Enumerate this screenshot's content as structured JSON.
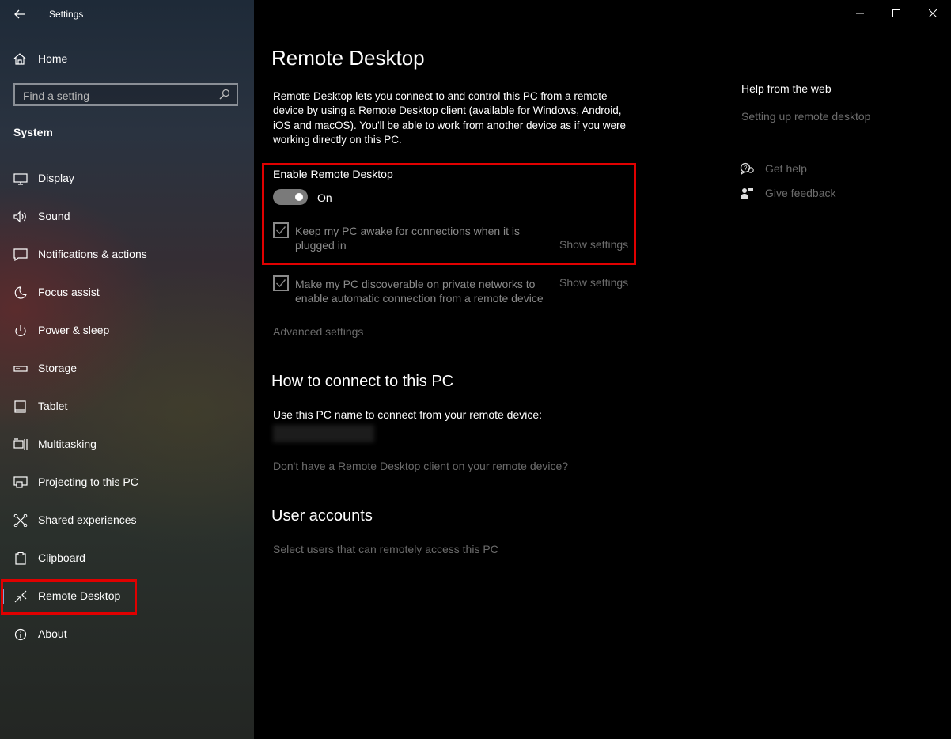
{
  "window": {
    "title": "Settings"
  },
  "sidebar": {
    "home_label": "Home",
    "search_placeholder": "Find a setting",
    "section": "System",
    "items": [
      {
        "label": "Display",
        "icon": "display-icon"
      },
      {
        "label": "Sound",
        "icon": "speaker-icon"
      },
      {
        "label": "Notifications & actions",
        "icon": "notification-icon"
      },
      {
        "label": "Focus assist",
        "icon": "moon-icon"
      },
      {
        "label": "Power & sleep",
        "icon": "power-icon"
      },
      {
        "label": "Storage",
        "icon": "storage-icon"
      },
      {
        "label": "Tablet",
        "icon": "tablet-icon"
      },
      {
        "label": "Multitasking",
        "icon": "multitasking-icon"
      },
      {
        "label": "Projecting to this PC",
        "icon": "projecting-icon"
      },
      {
        "label": "Shared experiences",
        "icon": "shared-icon"
      },
      {
        "label": "Clipboard",
        "icon": "clipboard-icon"
      },
      {
        "label": "Remote Desktop",
        "icon": "remote-desktop-icon",
        "selected": true
      },
      {
        "label": "About",
        "icon": "info-icon"
      }
    ]
  },
  "main": {
    "title": "Remote Desktop",
    "description": "Remote Desktop lets you connect to and control this PC from a remote device by using a Remote Desktop client (available for Windows, Android, iOS and macOS). You'll be able to work from another device as if you were working directly on this PC.",
    "enable_label": "Enable Remote Desktop",
    "toggle_state": "On",
    "keep_awake": "Keep my PC awake for connections when it is plugged in",
    "discoverable": "Make my PC discoverable on private networks to enable automatic connection from a remote device",
    "show_settings": "Show settings",
    "advanced_settings": "Advanced settings",
    "how_to_connect_heading": "How to connect to this PC",
    "pc_name_label": "Use this PC name to connect from your remote device:",
    "no_client_link": "Don't have a Remote Desktop client on your remote device?",
    "user_accounts_heading": "User accounts",
    "select_users_link": "Select users that can remotely access this PC"
  },
  "help": {
    "title": "Help from the web",
    "link": "Setting up remote desktop",
    "get_help": "Get help",
    "give_feedback": "Give feedback"
  },
  "colors": {
    "highlight": "#e00000",
    "muted": "#6c6c6c",
    "accent": "#7ea4d6"
  }
}
